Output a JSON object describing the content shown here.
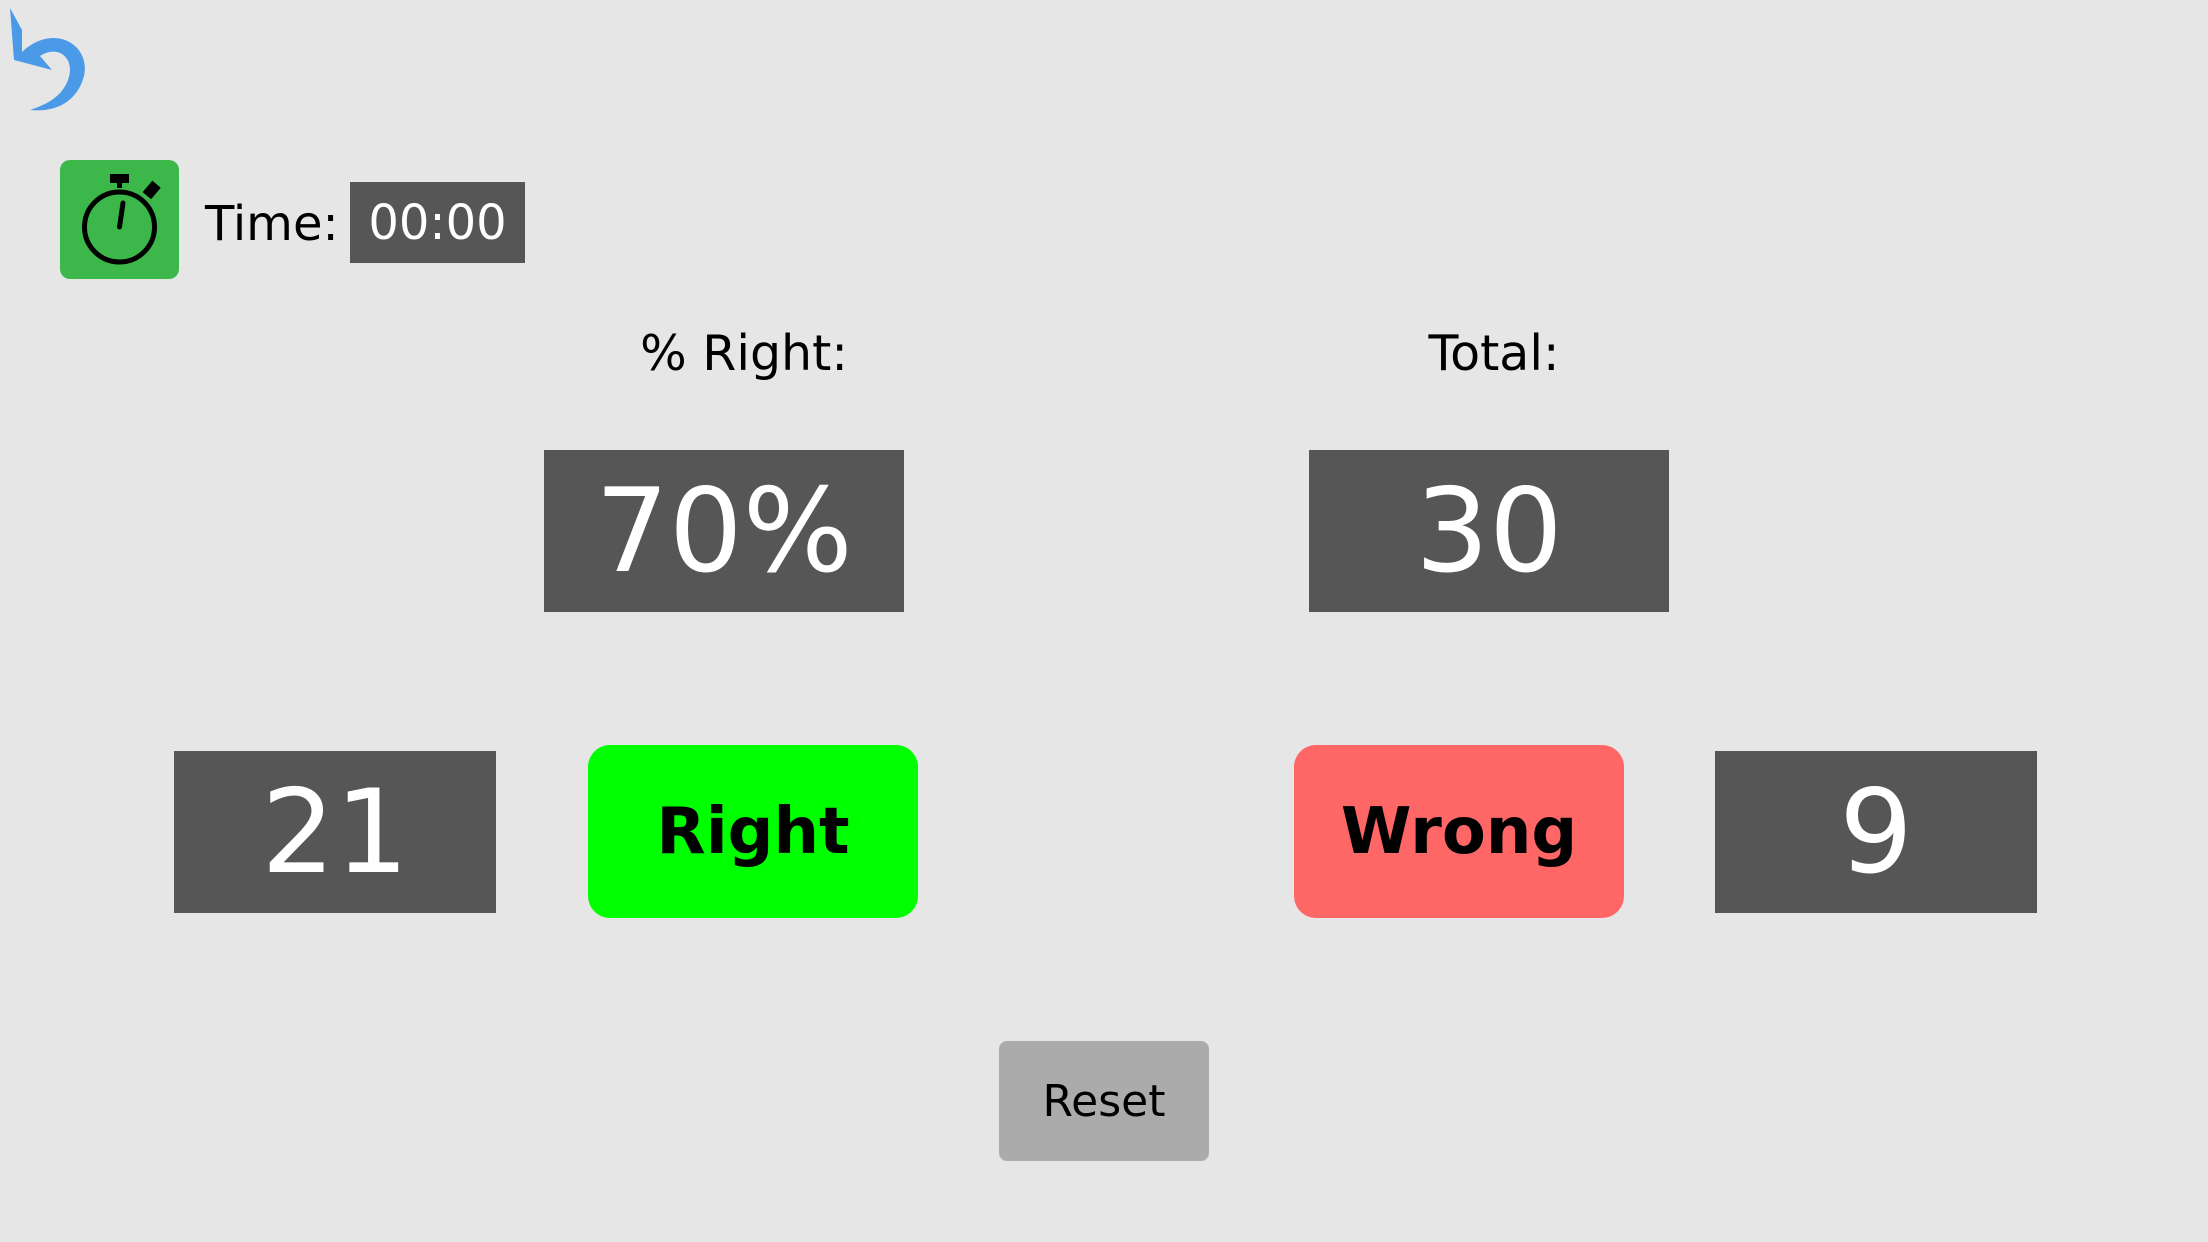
{
  "header": {
    "timer_icon": "stopwatch-icon",
    "timer_button_color": "#3cb84a",
    "time_label": "Time:",
    "time_value": "00:00",
    "undo_icon": "undo-arrow-icon",
    "undo_color": "#4a9ae8"
  },
  "stats": {
    "percent_label": "% Right:",
    "percent_value": "70%",
    "total_label": "Total:",
    "total_value": "30"
  },
  "counters": {
    "right_count": "21",
    "wrong_count": "9"
  },
  "buttons": {
    "right_label": "Right",
    "right_color": "#00ff00",
    "wrong_label": "Wrong",
    "wrong_color": "#ff6666",
    "reset_label": "Reset"
  }
}
